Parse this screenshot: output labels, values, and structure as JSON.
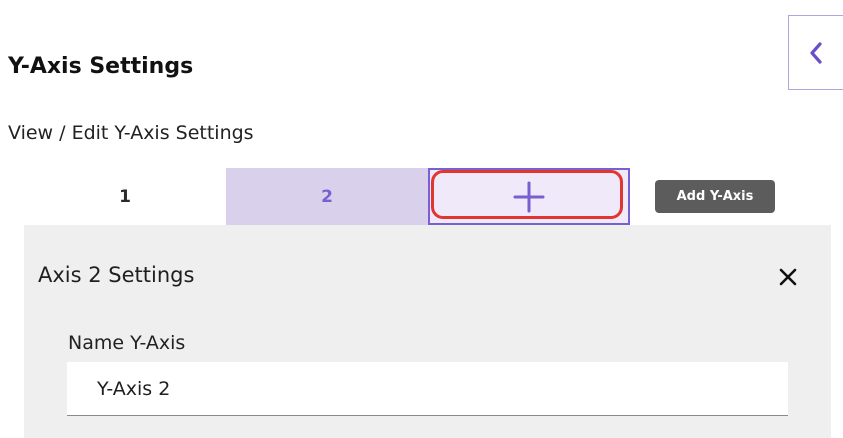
{
  "panel": {
    "title": "Y-Axis Settings",
    "subtitle": "View / Edit Y-Axis Settings",
    "collapse_icon": "chevron-left-icon"
  },
  "tabs": [
    {
      "label": "1",
      "selected": false
    },
    {
      "label": "2",
      "selected": true
    }
  ],
  "add_tab": {
    "icon": "plus-icon",
    "tooltip": "Add Y-Axis"
  },
  "axis_card": {
    "title": "Axis 2 Settings",
    "close_icon": "close-icon",
    "name_label": "Name Y-Axis",
    "name_value": "Y-Axis 2"
  },
  "colors": {
    "accent": "#7a5fd0",
    "selected_tab_bg": "#d9d1ec",
    "add_tab_bg": "#efe9fa",
    "highlight": "#e1352f",
    "tooltip_bg": "#5c5c5c",
    "card_bg": "#efefef"
  }
}
